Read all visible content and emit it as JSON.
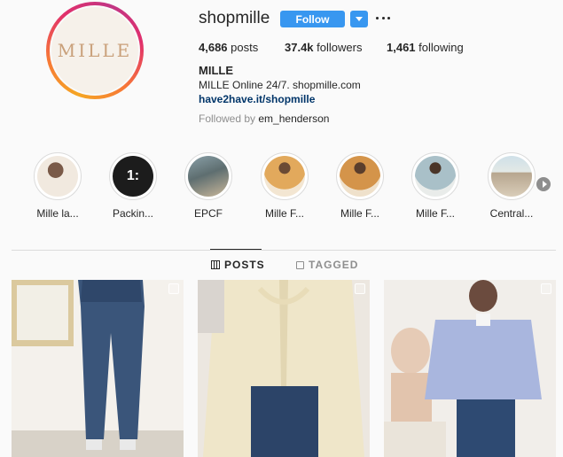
{
  "profile": {
    "username": "shopmille",
    "avatar_text": "MILLE",
    "follow_label": "Follow",
    "posts_count": "4,686",
    "posts_label": "posts",
    "followers_count": "37.4k",
    "followers_label": "followers",
    "following_count": "1,461",
    "following_label": "following",
    "name": "MILLE",
    "bio": "MILLE Online 24/7. shopmille.com",
    "link": "have2have.it/shopmille",
    "followed_by_prefix": "Followed by",
    "followed_by_user": "em_henderson"
  },
  "highlights": [
    {
      "label": "Mille la...",
      "color": "#e8ddd2"
    },
    {
      "label": "Packin...",
      "color": "#1c1c1c",
      "overlay": "1:"
    },
    {
      "label": "EPCF",
      "color": "#6a7a7e"
    },
    {
      "label": "Mille F...",
      "color": "#d9a35a"
    },
    {
      "label": "Mille F...",
      "color": "#d49a4e"
    },
    {
      "label": "Mille F...",
      "color": "#9ab0b8"
    },
    {
      "label": "Central...",
      "color": "#c9d4d0"
    }
  ],
  "tabs": {
    "posts": "POSTS",
    "tagged": "TAGGED"
  },
  "colors": {
    "accent": "#3897f0",
    "link": "#003569"
  }
}
